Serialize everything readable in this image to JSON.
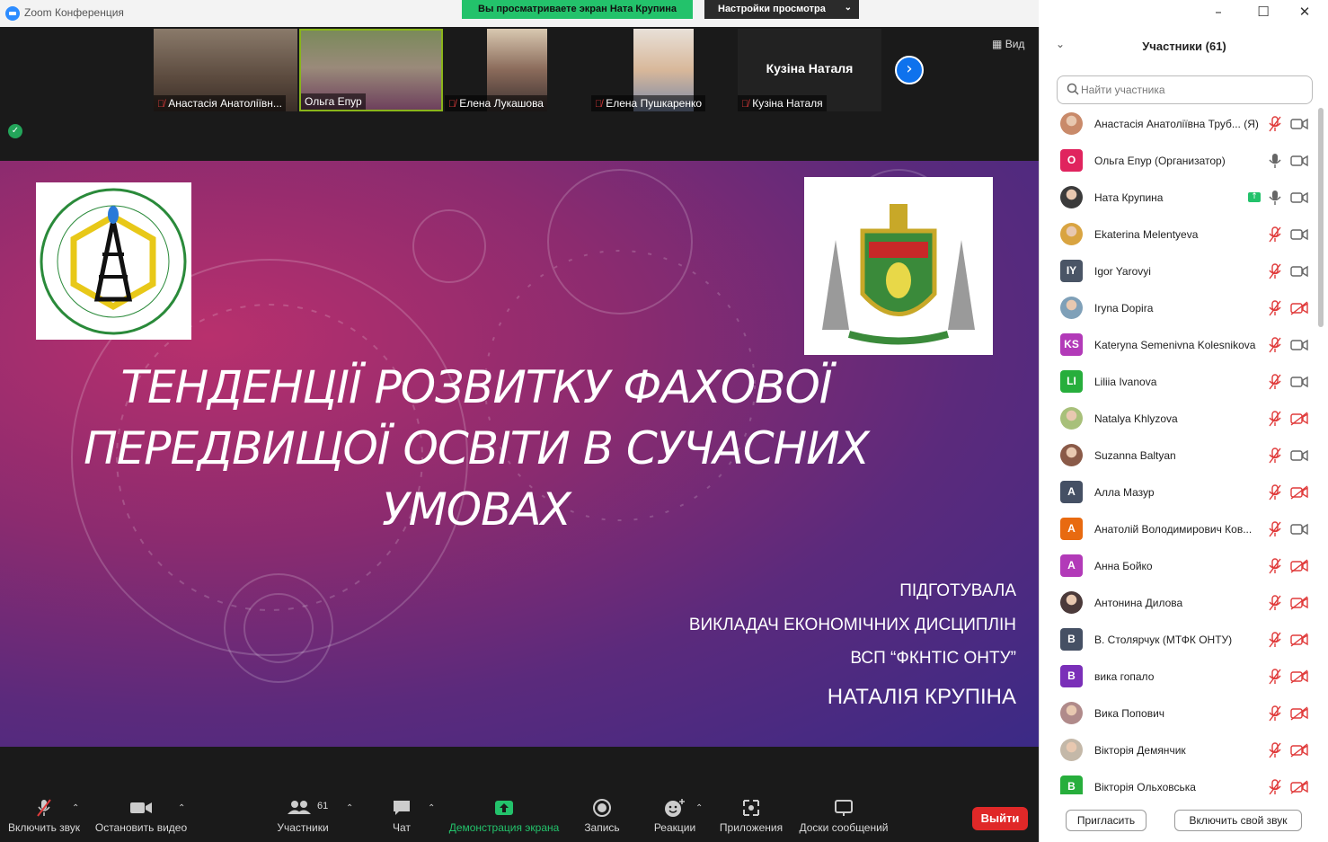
{
  "window": {
    "app_title": "Zoom Конференция",
    "viewing_banner": "Вы просматриваете экран Ната Крупина",
    "view_settings_label": "Настройки просмотра"
  },
  "thumbnails": [
    {
      "name": "Анастасія Анатоліївн...",
      "muted": true
    },
    {
      "name": "Ольга Епур",
      "muted": false
    },
    {
      "name": "Елена Лукашова",
      "muted": true
    },
    {
      "name": "Елена Пушкаренко",
      "muted": true
    },
    {
      "name": "Кузіна Наталя",
      "muted": true,
      "big_name": "Кузіна Наталя"
    }
  ],
  "view_button_label": "Вид",
  "slide": {
    "title_lines": [
      "ТЕНДЕНЦІЇ РОЗВИТКУ ФАХОВОЇ",
      "ПЕРЕДВИЩОЇ ОСВІТИ В СУЧАСНИХ",
      "УМОВАХ"
    ],
    "prepared_by": "ПІДГОТУВАЛА",
    "position": "ВИКЛАДАЧ ЕКОНОМІЧНИХ ДИСЦИПЛІН",
    "organization": "ВСП “ФКНТІС ОНТУ”",
    "author": "НАТАЛІЯ КРУПІНА"
  },
  "toolbar": {
    "audio_label": "Включить звук",
    "video_label": "Остановить видео",
    "participants_label": "Участники",
    "participants_count": "61",
    "chat_label": "Чат",
    "share_label": "Демонстрация экрана",
    "record_label": "Запись",
    "reactions_label": "Реакции",
    "apps_label": "Приложения",
    "whiteboards_label": "Доски сообщений",
    "leave_label": "Выйти"
  },
  "panel": {
    "title": "Участники (61)",
    "search_placeholder": "Найти участника",
    "invite_label": "Пригласить",
    "unmute_self_label": "Включить свой звук",
    "participants": [
      {
        "name": "Анастасія Анатоліївна Труб... (Я)",
        "avatar_type": "photo",
        "color": "#c98a6a",
        "mic": "muted",
        "video": "on"
      },
      {
        "name": "Ольга Епур (Организатор)",
        "avatar_type": "letter",
        "initials": "O",
        "color": "#e0245e",
        "mic": "on",
        "video": "on"
      },
      {
        "name": "Ната Крупина",
        "avatar_type": "photo",
        "color": "#3b3b3b",
        "mic": "on",
        "video": "on",
        "sharing": true
      },
      {
        "name": "Ekaterina Melentyeva",
        "avatar_type": "photo",
        "color": "#d9a441",
        "mic": "muted",
        "video": "on"
      },
      {
        "name": "Igor Yarovyi",
        "avatar_type": "letter",
        "initials": "IY",
        "color": "#4a5566",
        "mic": "muted",
        "video": "on"
      },
      {
        "name": "Iryna Dopira",
        "avatar_type": "photo",
        "color": "#7fa0b8",
        "mic": "muted",
        "video": "off"
      },
      {
        "name": "Kateryna Semenivna Kolesnikova",
        "avatar_type": "letter",
        "initials": "KS",
        "color": "#b23ab8",
        "mic": "muted",
        "video": "on"
      },
      {
        "name": "Liliia Ivanova",
        "avatar_type": "letter",
        "initials": "LI",
        "color": "#27ae3c",
        "mic": "muted",
        "video": "on"
      },
      {
        "name": "Natalya Khlyzova",
        "avatar_type": "photo",
        "color": "#a8c07a",
        "mic": "muted",
        "video": "off"
      },
      {
        "name": "Suzanna Baltyan",
        "avatar_type": "photo",
        "color": "#8a5a48",
        "mic": "muted",
        "video": "on"
      },
      {
        "name": "Алла Мазур",
        "avatar_type": "letter",
        "initials": "A",
        "color": "#455064",
        "mic": "muted",
        "video": "off"
      },
      {
        "name": "Анатолій Володимирович Ков...",
        "avatar_type": "letter",
        "initials": "A",
        "color": "#e86a10",
        "mic": "muted",
        "video": "on"
      },
      {
        "name": "Анна Бойко",
        "avatar_type": "letter",
        "initials": "A",
        "color": "#b23ab8",
        "mic": "muted",
        "video": "off"
      },
      {
        "name": "Антонина Дилова",
        "avatar_type": "photo",
        "color": "#4b3a3a",
        "mic": "muted",
        "video": "off"
      },
      {
        "name": "В. Столярчук (МТФК ОНТУ)",
        "avatar_type": "letter",
        "initials": "B",
        "color": "#455064",
        "mic": "muted",
        "video": "off"
      },
      {
        "name": "вика гопало",
        "avatar_type": "letter",
        "initials": "B",
        "color": "#7a2fb8",
        "mic": "muted",
        "video": "off"
      },
      {
        "name": "Вика Попович",
        "avatar_type": "photo",
        "color": "#b08a8a",
        "mic": "muted",
        "video": "off"
      },
      {
        "name": "Вікторія Демянчик",
        "avatar_type": "photo",
        "color": "#c4b8a8",
        "mic": "muted",
        "video": "off"
      },
      {
        "name": "Вікторія Ольховська",
        "avatar_type": "letter",
        "initials": "B",
        "color": "#27ae3c",
        "mic": "muted",
        "video": "off"
      }
    ]
  },
  "colors": {
    "banner_green": "#23c26b",
    "zoom_blue": "#0e72ed",
    "leave_red": "#e02828",
    "muted_red": "#e03b3b"
  }
}
